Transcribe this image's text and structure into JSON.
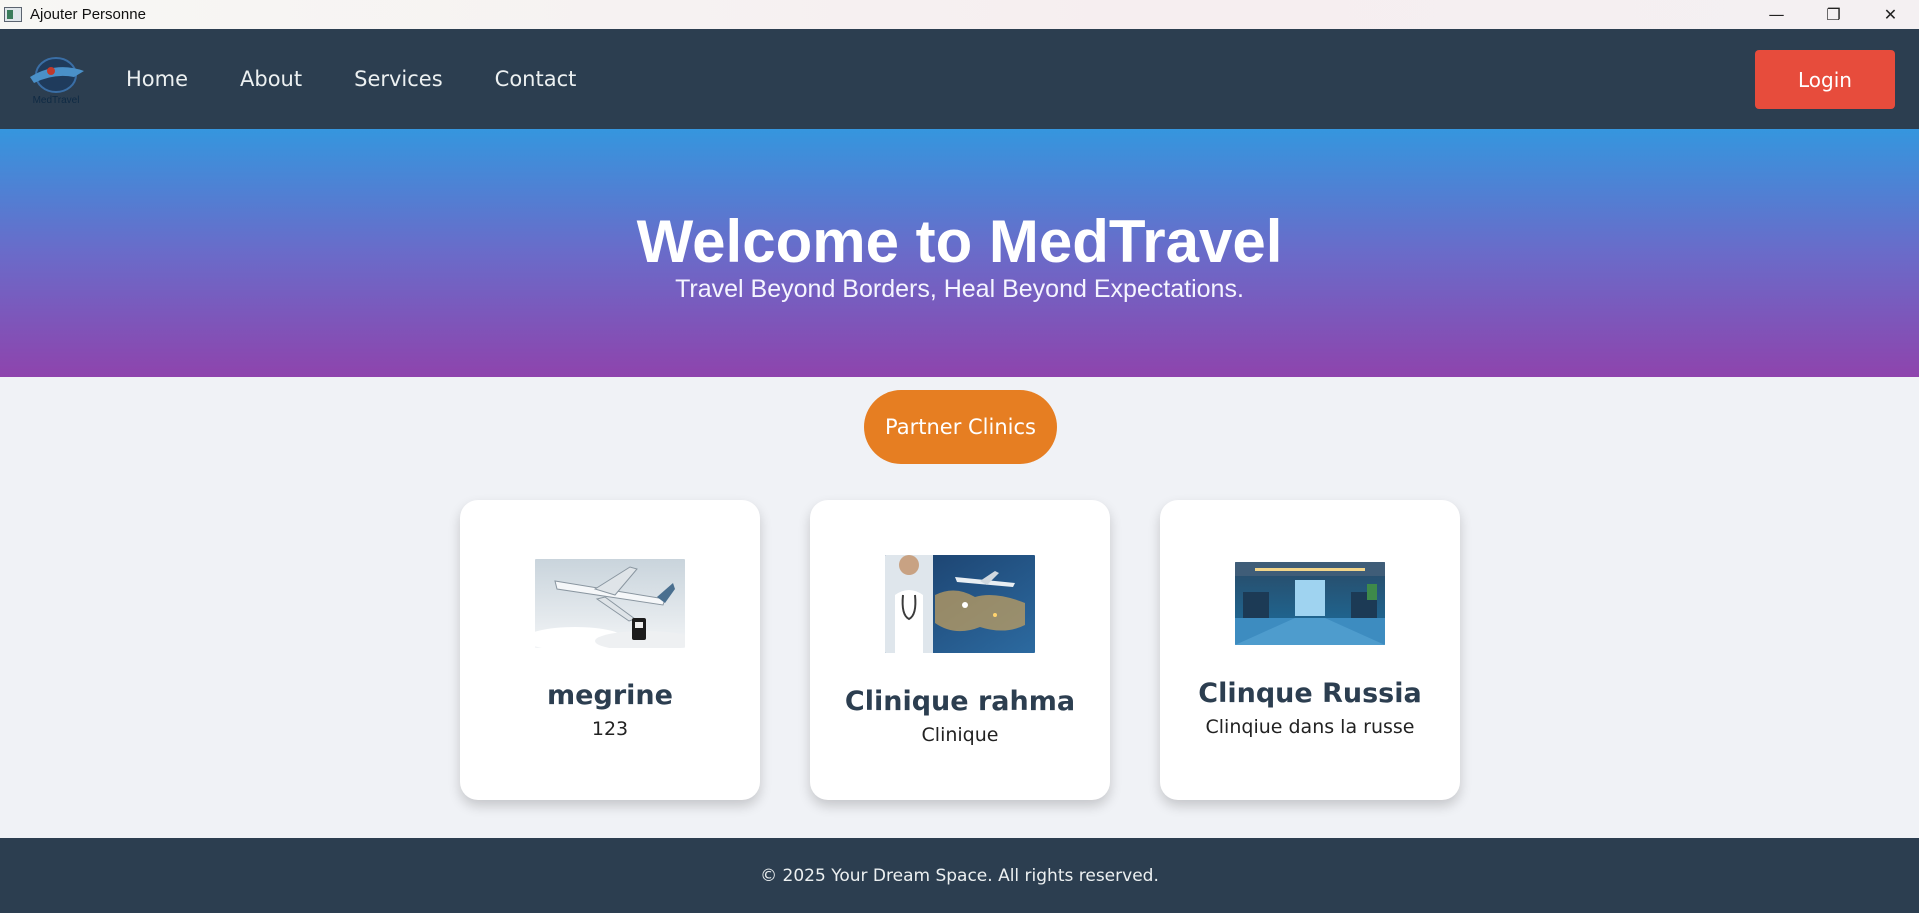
{
  "window": {
    "title": "Ajouter Personne",
    "controls": {
      "minimize": "—",
      "restore": "❐",
      "close": "✕"
    }
  },
  "nav": {
    "logo_icon": "medtravel-logo",
    "logo_text": "MedTravel",
    "links": [
      "Home",
      "About",
      "Services",
      "Contact"
    ],
    "login_label": "Login"
  },
  "hero": {
    "title": "Welcome to MedTravel",
    "subtitle": "Travel Beyond Borders, Heal Beyond Expectations."
  },
  "partner_button": {
    "label": "Partner Clinics"
  },
  "cards": [
    {
      "name": "megrine",
      "description": "123",
      "image": "airplane-image"
    },
    {
      "name": "Clinique rahma",
      "description": "Clinique",
      "image": "doctor-world-map-image"
    },
    {
      "name": "Clinque Russia",
      "description": "Clinqiue dans la russe",
      "image": "hospital-lobby-image"
    }
  ],
  "footer": {
    "text": "© 2025 Your Dream Space. All rights reserved."
  },
  "colors": {
    "navbar": "#2c3e50",
    "login": "#e74c3c",
    "partner": "#e67e22",
    "hero_top": "#3596de",
    "hero_bottom": "#8e44ad",
    "footer": "#2c3e50"
  }
}
